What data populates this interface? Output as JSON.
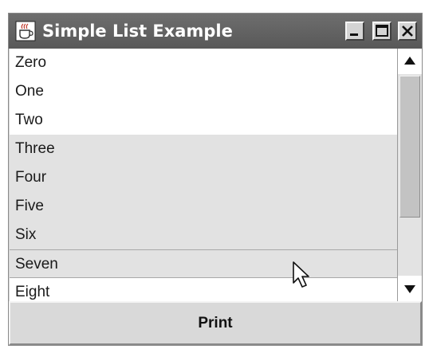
{
  "window": {
    "title": "Simple List Example",
    "controls": {
      "minimize": "minimize-icon",
      "maximize": "maximize-icon",
      "close": "close-icon"
    }
  },
  "list": {
    "items": [
      {
        "label": "Zero",
        "selected": false
      },
      {
        "label": "One",
        "selected": false
      },
      {
        "label": "Two",
        "selected": false
      },
      {
        "label": "Three",
        "selected": true
      },
      {
        "label": "Four",
        "selected": true
      },
      {
        "label": "Five",
        "selected": true
      },
      {
        "label": "Six",
        "selected": true
      },
      {
        "label": "Seven",
        "selected": true
      },
      {
        "label": "Eight",
        "selected": false
      }
    ],
    "selection_color": "#e2e2e2"
  },
  "scrollbar": {
    "up_icon": "arrow-up-icon",
    "down_icon": "arrow-down-icon"
  },
  "actions": {
    "print_label": "Print"
  },
  "colors": {
    "titlebar": "#5e5e5e",
    "window_bg": "#d6d6d6"
  }
}
